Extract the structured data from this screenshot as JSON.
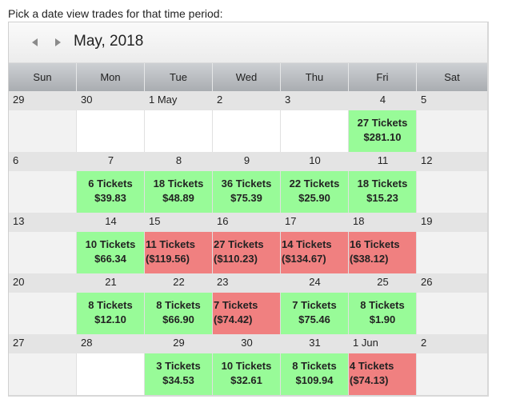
{
  "prompt": "Pick a date view trades for that time period:",
  "calendar": {
    "title": "May, 2018",
    "prev_icon": "triangle-left-icon",
    "next_icon": "triangle-right-icon",
    "days_of_week": [
      "Sun",
      "Mon",
      "Tue",
      "Wed",
      "Thu",
      "Fri",
      "Sat"
    ],
    "colors": {
      "profit": "#98fb98",
      "loss": "#f08080",
      "weekend": "#f2f2f2"
    },
    "weeks": [
      {
        "days": [
          {
            "label": "29",
            "type": "weekend"
          },
          {
            "label": "30",
            "type": "empty"
          },
          {
            "label": "1 May",
            "type": "empty"
          },
          {
            "label": "2",
            "type": "empty"
          },
          {
            "label": "3",
            "type": "empty"
          },
          {
            "label": "4",
            "type": "profit",
            "tickets": "27 Tickets",
            "amount": "$281.10"
          },
          {
            "label": "5",
            "type": "weekend"
          }
        ]
      },
      {
        "days": [
          {
            "label": "6",
            "type": "weekend"
          },
          {
            "label": "7",
            "type": "profit",
            "tickets": "6 Tickets",
            "amount": "$39.83"
          },
          {
            "label": "8",
            "type": "profit",
            "tickets": "18 Tickets",
            "amount": "$48.89"
          },
          {
            "label": "9",
            "type": "profit",
            "tickets": "36 Tickets",
            "amount": "$75.39"
          },
          {
            "label": "10",
            "type": "profit",
            "tickets": "22 Tickets",
            "amount": "$25.90"
          },
          {
            "label": "11",
            "type": "profit",
            "tickets": "18 Tickets",
            "amount": "$15.23"
          },
          {
            "label": "12",
            "type": "weekend"
          }
        ]
      },
      {
        "days": [
          {
            "label": "13",
            "type": "weekend"
          },
          {
            "label": "14",
            "type": "profit",
            "tickets": "10 Tickets",
            "amount": "$66.34"
          },
          {
            "label": "15",
            "type": "loss",
            "tickets": "11 Tickets",
            "amount": "($119.56)"
          },
          {
            "label": "16",
            "type": "loss",
            "tickets": "27 Tickets",
            "amount": "($110.23)"
          },
          {
            "label": "17",
            "type": "loss",
            "tickets": "14 Tickets",
            "amount": "($134.67)"
          },
          {
            "label": "18",
            "type": "loss",
            "tickets": "16 Tickets",
            "amount": "($38.12)"
          },
          {
            "label": "19",
            "type": "weekend"
          }
        ]
      },
      {
        "days": [
          {
            "label": "20",
            "type": "weekend"
          },
          {
            "label": "21",
            "type": "profit",
            "tickets": "8 Tickets",
            "amount": "$12.10"
          },
          {
            "label": "22",
            "type": "profit",
            "tickets": "8 Tickets",
            "amount": "$66.90"
          },
          {
            "label": "23",
            "type": "loss",
            "tickets": "7 Tickets",
            "amount": "($74.42)"
          },
          {
            "label": "24",
            "type": "profit",
            "tickets": "7 Tickets",
            "amount": "$75.46"
          },
          {
            "label": "25",
            "type": "profit",
            "tickets": "8 Tickets",
            "amount": "$1.90"
          },
          {
            "label": "26",
            "type": "weekend"
          }
        ]
      },
      {
        "days": [
          {
            "label": "27",
            "type": "weekend"
          },
          {
            "label": "28",
            "type": "empty"
          },
          {
            "label": "29",
            "type": "profit",
            "tickets": "3 Tickets",
            "amount": "$34.53"
          },
          {
            "label": "30",
            "type": "profit",
            "tickets": "10 Tickets",
            "amount": "$32.61"
          },
          {
            "label": "31",
            "type": "profit",
            "tickets": "8 Tickets",
            "amount": "$109.94"
          },
          {
            "label": "1 Jun",
            "type": "loss",
            "tickets": "4 Tickets",
            "amount": "($74.13)"
          },
          {
            "label": "2",
            "type": "weekend"
          }
        ]
      }
    ]
  }
}
